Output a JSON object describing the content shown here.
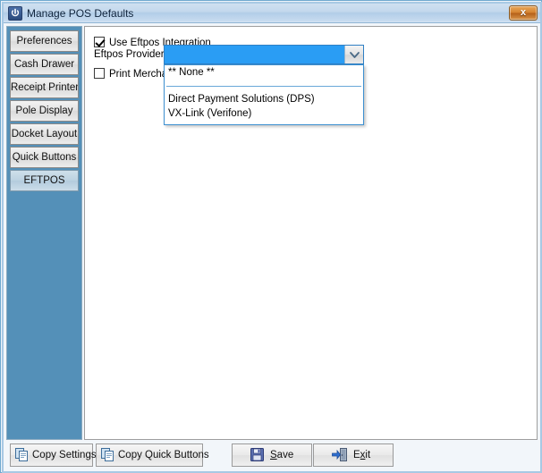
{
  "window": {
    "title": "Manage POS Defaults",
    "app_icon": "power-icon",
    "close_label": "x"
  },
  "sidebar": {
    "tabs": [
      {
        "label": "Preferences",
        "selected": false
      },
      {
        "label": "Cash Drawer",
        "selected": false
      },
      {
        "label": "Receipt Printer",
        "selected": false
      },
      {
        "label": "Pole Display",
        "selected": false
      },
      {
        "label": "Docket Layout",
        "selected": false
      },
      {
        "label": "Quick Buttons",
        "selected": false
      },
      {
        "label": "EFTPOS",
        "selected": true
      }
    ]
  },
  "main": {
    "use_eftpos_integration": {
      "label": "Use Eftpos Integration",
      "checked": true
    },
    "eftpos_provider": {
      "label": "Eftpos Provider",
      "value": "",
      "expanded": true,
      "arrow_icon": "chevron-down-icon",
      "options": [
        "** None **",
        "Direct Payment Solutions (DPS)",
        "VX-Link (Verifone)"
      ],
      "separator_after_index": 0
    },
    "print_merchant": {
      "label": "Print Merchan",
      "checked": false
    }
  },
  "buttons": {
    "copy_settings": {
      "label": "Copy Settings",
      "icon": "copy-icon"
    },
    "copy_quick_buttons": {
      "label": "Copy Quick Buttons",
      "icon": "copy-icon"
    },
    "save": {
      "accel": "S",
      "rest": "ave",
      "icon": "floppy-disk-icon"
    },
    "exit": {
      "pre": "E",
      "accel": "x",
      "rest": "it",
      "icon": "exit-door-icon"
    }
  },
  "colors": {
    "sidebar_bg": "#5490b8",
    "combo_highlight": "#2a9df4",
    "title_bar": "#c3d8ed",
    "close_button": "#d4822f",
    "selected_tab": "#bcd2e1"
  }
}
